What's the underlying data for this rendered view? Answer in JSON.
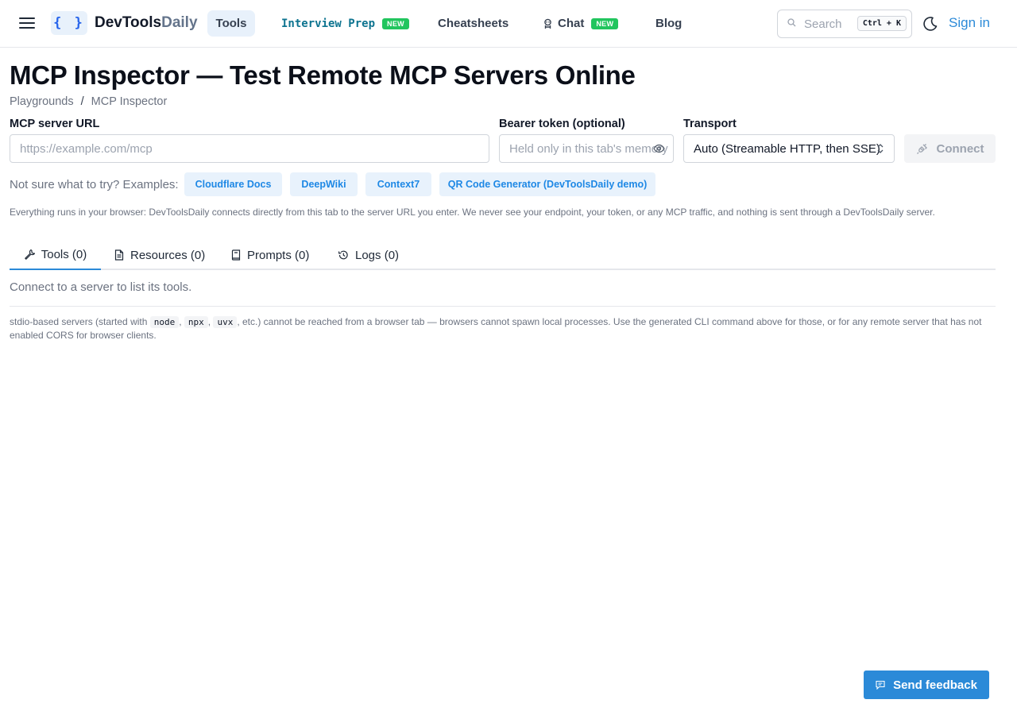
{
  "header": {
    "logo_glyph": "{ }",
    "logo_primary": "DevTools",
    "logo_secondary": "Daily",
    "nav": {
      "tools": "Tools",
      "interview_prep": "Interview Prep",
      "cheatsheets": "Cheatsheets",
      "chat": "Chat",
      "blog": "Blog"
    },
    "new_badge": "NEW",
    "search_placeholder": "Search",
    "search_shortcut": "Ctrl + K",
    "sign_in": "Sign in"
  },
  "page": {
    "title": "MCP Inspector — Test Remote MCP Servers Online",
    "breadcrumb": [
      "Playgrounds",
      "/",
      "MCP Inspector"
    ]
  },
  "form": {
    "url_label": "MCP server URL",
    "url_placeholder": "https://example.com/mcp",
    "token_label": "Bearer token (optional)",
    "token_placeholder": "Held only in this tab's memory",
    "transport_label": "Transport",
    "transport_value": "Auto (Streamable HTTP, then SSE)",
    "connect_label": "Connect"
  },
  "examples": {
    "label": "Not sure what to try? Examples:",
    "items": [
      "Cloudflare Docs",
      "DeepWiki",
      "Context7",
      "QR Code Generator (DevToolsDaily demo)"
    ]
  },
  "notice": "Everything runs in your browser: DevToolsDaily connects directly from this tab to the server URL you enter. We never see your endpoint, your token, or any MCP traffic, and nothing is sent through a DevToolsDaily server.",
  "tabs": [
    {
      "label": "Tools (0)",
      "icon": "wrench-icon"
    },
    {
      "label": "Resources (0)",
      "icon": "document-icon"
    },
    {
      "label": "Prompts (0)",
      "icon": "book-icon"
    },
    {
      "label": "Logs (0)",
      "icon": "history-icon"
    }
  ],
  "empty_message": "Connect to a server to list its tools.",
  "stdio_note": {
    "prefix": "stdio-based servers (started with ",
    "cmd1": "node",
    "sep1": ", ",
    "cmd2": "npx",
    "sep2": ", ",
    "cmd3": "uvx",
    "suffix": ", etc.) cannot be reached from a browser tab — browsers cannot spawn local processes. Use the generated CLI command above for those, or for any remote server that has not enabled CORS for browser clients."
  },
  "feedback_button": "Send feedback",
  "colors": {
    "accent": "#2b8ad8",
    "chip_text": "#1e88e5",
    "chip_bg": "#e8f2fc",
    "new_badge": "#22c55e"
  }
}
